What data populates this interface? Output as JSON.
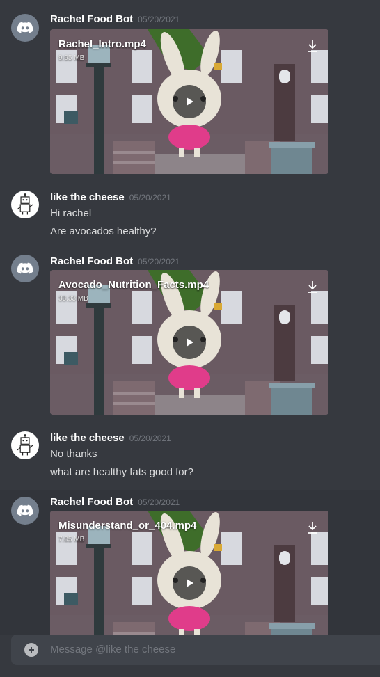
{
  "channel": {
    "input_placeholder": "Message @like the cheese"
  },
  "messages": [
    {
      "author": "Rachel Food Bot",
      "timestamp": "05/20/2021",
      "video": {
        "filename": "Rachel_Intro.mp4",
        "size": "9.95 MB"
      }
    },
    {
      "author": "like the cheese",
      "timestamp": "05/20/2021",
      "lines": [
        "Hi rachel",
        "Are avocados healthy?"
      ]
    },
    {
      "author": "Rachel Food Bot",
      "timestamp": "05/20/2021",
      "video": {
        "filename": "Avocado_Nutrition_Facts.mp4",
        "size": "33.33 MB"
      }
    },
    {
      "author": "like the cheese",
      "timestamp": "05/20/2021",
      "lines": [
        "No thanks",
        "what are healthy fats good for?"
      ]
    },
    {
      "author": "Rachel Food Bot",
      "timestamp": "05/20/2021",
      "video": {
        "filename": "Misunderstand_or_404.mp4",
        "size": "7.05 MB"
      }
    }
  ],
  "colors": {
    "background": "#36393f",
    "input": "#40444b",
    "bot_avatar": "#747f8d",
    "character_dress": "#e03c8a"
  },
  "icons": {
    "bot_avatar": "discord-logo-icon",
    "user_avatar": "robot-icon",
    "download": "download-icon",
    "play": "play-icon",
    "attach": "plus-circle-icon"
  }
}
